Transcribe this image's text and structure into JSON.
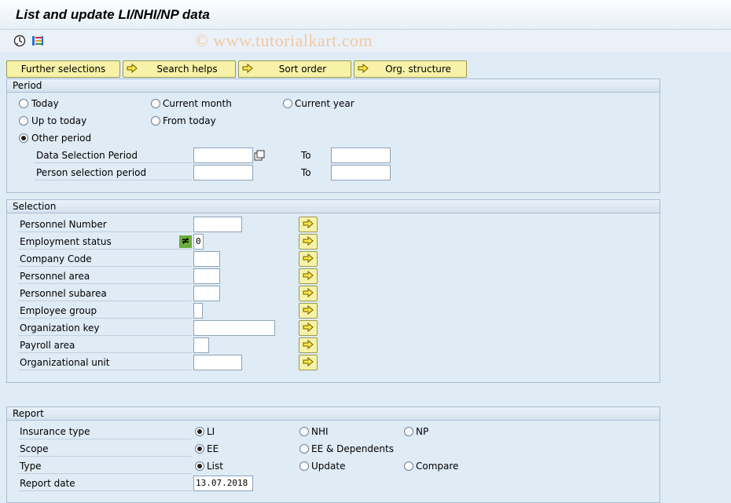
{
  "title": "List and update LI/NHI/NP data",
  "watermark": "© www.tutorialkart.com",
  "toolbar": {
    "icons": [
      "execute-icon",
      "get-variant-icon"
    ]
  },
  "tabs": [
    {
      "label": "Further selections",
      "icon": ""
    },
    {
      "label": "Search helps",
      "icon": "arrow-icon"
    },
    {
      "label": "Sort order",
      "icon": "arrow-icon"
    },
    {
      "label": "Org. structure",
      "icon": "arrow-icon"
    }
  ],
  "period": {
    "header": "Period",
    "options": {
      "today": "Today",
      "current_month": "Current month",
      "current_year": "Current year",
      "up_to_today": "Up to today",
      "from_today": "From today",
      "other_period": "Other period"
    },
    "selected": "other_period",
    "data_selection_label": "Data Selection Period",
    "person_selection_label": "Person selection period",
    "to_label": "To",
    "data_from": "",
    "data_to": "",
    "person_from": "",
    "person_to": ""
  },
  "selection": {
    "header": "Selection",
    "rows": [
      {
        "label": "Personnel Number",
        "value": ""
      },
      {
        "label": "Employment status",
        "value": "0",
        "operator": "≠"
      },
      {
        "label": "Company Code",
        "value": ""
      },
      {
        "label": "Personnel area",
        "value": ""
      },
      {
        "label": "Personnel subarea",
        "value": ""
      },
      {
        "label": "Employee group",
        "value": ""
      },
      {
        "label": "Organization key",
        "value": ""
      },
      {
        "label": "Payroll area",
        "value": ""
      },
      {
        "label": "Organizational unit",
        "value": ""
      }
    ]
  },
  "report": {
    "header": "Report",
    "insurance_label": "Insurance type",
    "insurance_options": [
      "LI",
      "NHI",
      "NP"
    ],
    "insurance_selected": "LI",
    "scope_label": "Scope",
    "scope_options": [
      "EE",
      "EE & Dependents"
    ],
    "scope_selected": "EE",
    "type_label": "Type",
    "type_options": [
      "List",
      "Update",
      "Compare"
    ],
    "type_selected": "List",
    "date_label": "Report date",
    "date_value": "13.07.2018"
  },
  "colors": {
    "background": "#dfebf5",
    "button": "#f7f2a7",
    "neq_operator": "#6cae3c",
    "watermark": "#f0c9a4"
  }
}
